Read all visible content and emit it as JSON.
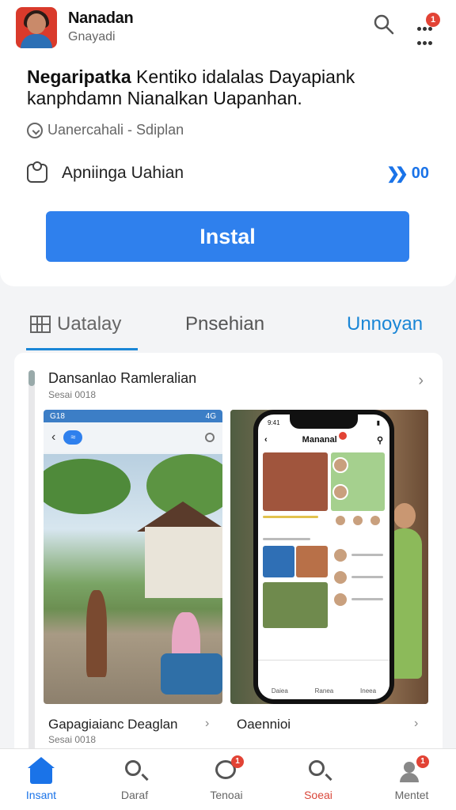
{
  "header": {
    "app_name": "Nanadan",
    "app_subtitle": "Gnayadi",
    "more_badge": "1"
  },
  "headline": {
    "bold": "Negaripatka",
    "rest": " Kentiko idalalas Dayapiank kanphdamn Nianalkan Uapanhan."
  },
  "meta": {
    "text": "Uanercahali - Sdiplan"
  },
  "feature": {
    "label": "Apniinga Uahian",
    "right_value": "00"
  },
  "install": {
    "label": "Instal"
  },
  "tabs": [
    {
      "label": "Uatalay"
    },
    {
      "label": "Pnsehian"
    },
    {
      "label": "Unnoyan"
    }
  ],
  "section": {
    "title": "Dansanlao Ramleralian",
    "subtitle": "Sesai 0018"
  },
  "screenshot1": {
    "status_left": "G18",
    "status_right": "4G",
    "caption": "Gapagiaianc Deaglan",
    "caption_sub": "Sesai 0018"
  },
  "screenshot2": {
    "phone_title": "Mananal",
    "nav_labels": [
      "Daiea",
      "Ranea",
      "Ineea"
    ],
    "caption": "Oaennioi"
  },
  "bottom_nav": [
    {
      "label": "Insant",
      "icon": "home-icon"
    },
    {
      "label": "Daraf",
      "icon": "search-icon"
    },
    {
      "label": "Tenoai",
      "icon": "chat-icon",
      "badge": "1"
    },
    {
      "label": "Soeai",
      "icon": "search-icon"
    },
    {
      "label": "Mentet",
      "icon": "user-icon",
      "badge": "1"
    }
  ],
  "colors": {
    "accent": "#2f80ed",
    "tab_active": "#1a86d6",
    "badge": "#e24335",
    "app_icon_bg": "#d93a2b"
  }
}
